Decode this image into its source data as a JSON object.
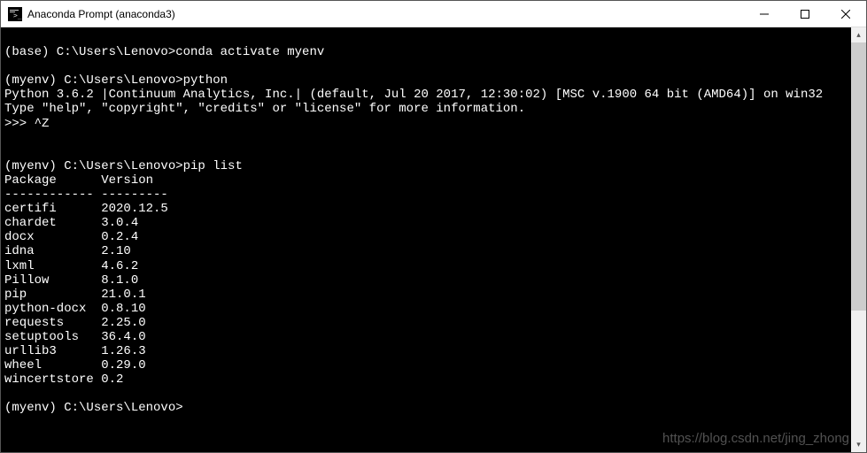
{
  "titlebar": {
    "title": "Anaconda Prompt (anaconda3)"
  },
  "terminal": {
    "lines": [
      "",
      "(base) C:\\Users\\Lenovo>conda activate myenv",
      "",
      "(myenv) C:\\Users\\Lenovo>python",
      "Python 3.6.2 |Continuum Analytics, Inc.| (default, Jul 20 2017, 12:30:02) [MSC v.1900 64 bit (AMD64)] on win32",
      "Type \"help\", \"copyright\", \"credits\" or \"license\" for more information.",
      ">>> ^Z",
      "",
      "",
      "(myenv) C:\\Users\\Lenovo>pip list",
      "Package      Version",
      "------------ ---------",
      "certifi      2020.12.5",
      "chardet      3.0.4",
      "docx         0.2.4",
      "idna         2.10",
      "lxml         4.6.2",
      "Pillow       8.1.0",
      "pip          21.0.1",
      "python-docx  0.8.10",
      "requests     2.25.0",
      "setuptools   36.4.0",
      "urllib3      1.26.3",
      "wheel        0.29.0",
      "wincertstore 0.2",
      "",
      "(myenv) C:\\Users\\Lenovo>"
    ]
  },
  "pip_list": {
    "header": [
      "Package",
      "Version"
    ],
    "rows": [
      {
        "package": "certifi",
        "version": "2020.12.5"
      },
      {
        "package": "chardet",
        "version": "3.0.4"
      },
      {
        "package": "docx",
        "version": "0.2.4"
      },
      {
        "package": "idna",
        "version": "2.10"
      },
      {
        "package": "lxml",
        "version": "4.6.2"
      },
      {
        "package": "Pillow",
        "version": "8.1.0"
      },
      {
        "package": "pip",
        "version": "21.0.1"
      },
      {
        "package": "python-docx",
        "version": "0.8.10"
      },
      {
        "package": "requests",
        "version": "2.25.0"
      },
      {
        "package": "setuptools",
        "version": "36.4.0"
      },
      {
        "package": "urllib3",
        "version": "1.26.3"
      },
      {
        "package": "wheel",
        "version": "0.29.0"
      },
      {
        "package": "wincertstore",
        "version": "0.2"
      }
    ]
  },
  "python_info": {
    "version": "3.6.2",
    "distributor": "Continuum Analytics, Inc.",
    "build_date": "Jul 20 2017, 12:30:02",
    "compiler": "MSC v.1900 64 bit (AMD64)",
    "platform": "win32"
  },
  "prompts": {
    "base": "(base) C:\\Users\\Lenovo>",
    "myenv": "(myenv) C:\\Users\\Lenovo>",
    "python": ">>>"
  },
  "commands": {
    "activate": "conda activate myenv",
    "python": "python",
    "pip_list": "pip list",
    "exit_python": "^Z"
  },
  "scrollbar": {
    "thumb_top_pct": 0,
    "thumb_height_pct": 68
  },
  "watermark": "https://blog.csdn.net/jing_zhong"
}
